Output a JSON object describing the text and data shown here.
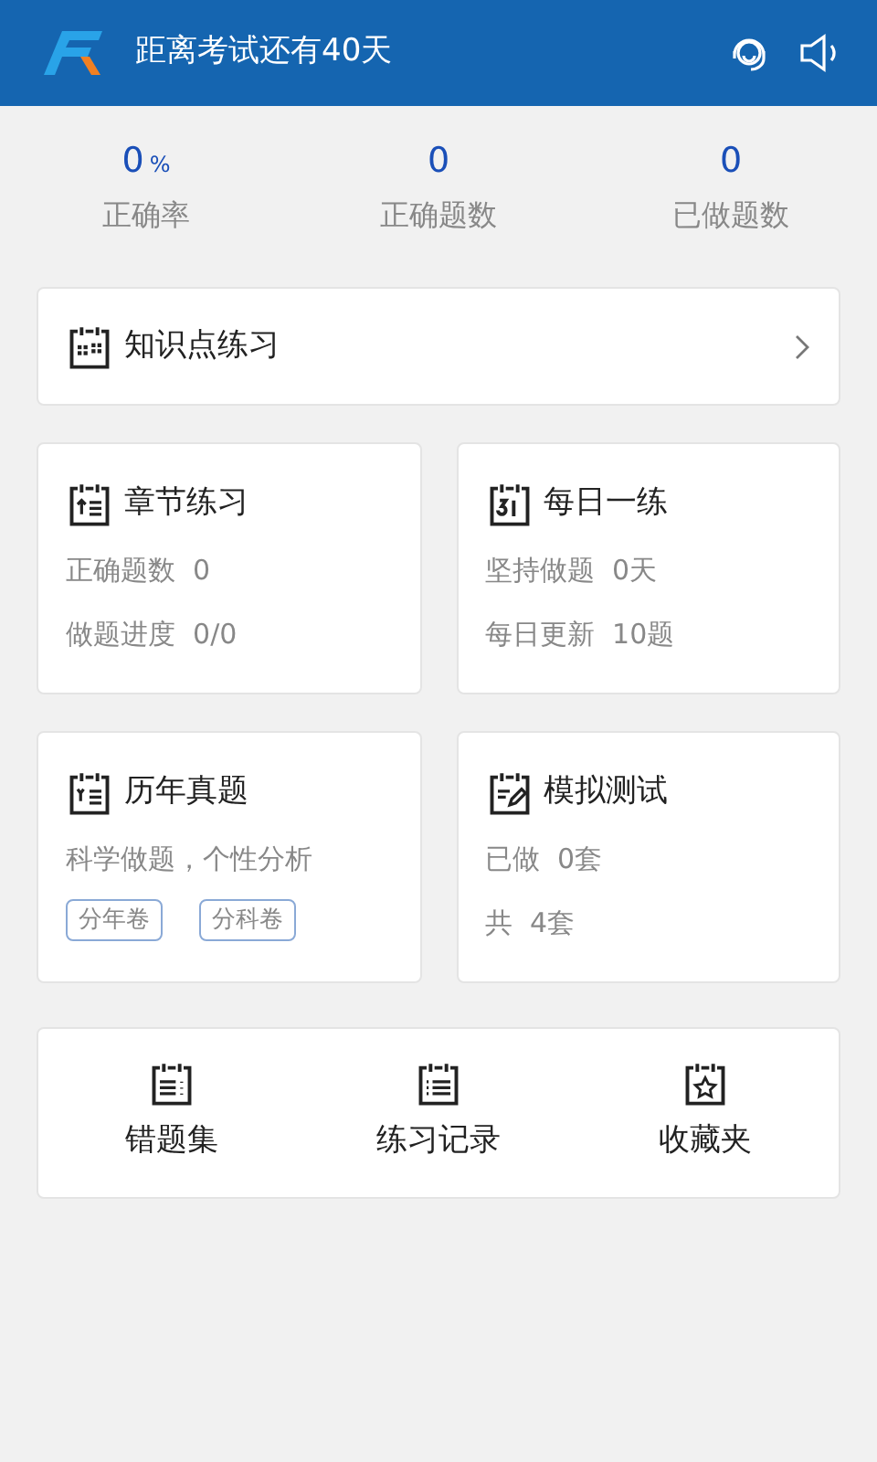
{
  "header": {
    "title": "距离考试还有40天"
  },
  "stats": [
    {
      "value": "0",
      "unit": "%",
      "label": "正确率"
    },
    {
      "value": "0",
      "label": "正确题数"
    },
    {
      "value": "0",
      "label": "已做题数"
    }
  ],
  "knowledge": {
    "title": "知识点练习"
  },
  "cards": [
    {
      "title": "章节练习",
      "lines": [
        "正确题数  0",
        "做题进度  0/0"
      ]
    },
    {
      "title": "每日一练",
      "lines": [
        "坚持做题  0天",
        "每日更新  10题"
      ]
    },
    {
      "title": "历年真题",
      "lines": [
        "科学做题，个性分析"
      ],
      "tags": [
        "分年卷",
        "分科卷"
      ]
    },
    {
      "title": "模拟测试",
      "lines": [
        "已做  0套",
        "共  4套"
      ]
    }
  ],
  "shortcuts": [
    {
      "label": "错题集"
    },
    {
      "label": "练习记录"
    },
    {
      "label": "收藏夹"
    }
  ]
}
